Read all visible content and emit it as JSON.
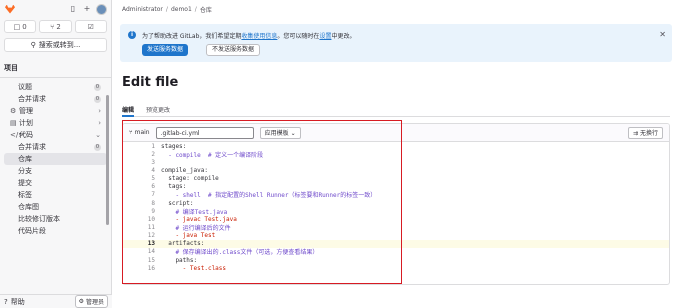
{
  "sidebar": {
    "counts": [
      {
        "icon": "□",
        "value": "0"
      },
      {
        "icon": "⑂",
        "value": "2"
      },
      {
        "icon": "☑",
        "value": ""
      }
    ],
    "search": "搜索或转到...",
    "project_label": "项目",
    "items": [
      {
        "label": "议题",
        "badge": "0",
        "sub": true
      },
      {
        "label": "合并请求",
        "badge": "0",
        "sub": true
      },
      {
        "label": "管理",
        "icon": "⚙",
        "chev": "›"
      },
      {
        "label": "计划",
        "icon": "▤",
        "chev": "›"
      },
      {
        "label": "代码",
        "icon": "</>",
        "chev": "⌄"
      },
      {
        "label": "合并请求",
        "badge": "0",
        "sub": true
      },
      {
        "label": "仓库",
        "sub": true,
        "active": true
      },
      {
        "label": "分支",
        "sub": true
      },
      {
        "label": "提交",
        "sub": true
      },
      {
        "label": "标签",
        "sub": true
      },
      {
        "label": "仓库图",
        "sub": true
      },
      {
        "label": "比较修订版本",
        "sub": true
      },
      {
        "label": "代码片段",
        "sub": true
      }
    ],
    "help": "帮助",
    "admin": "管理员"
  },
  "breadcrumb": [
    "Administrator",
    "demo1",
    "仓库"
  ],
  "alert": {
    "msg_pre": "为了帮助改进 GitLab，我们希望定期",
    "msg_link1": "收集使用信息",
    "msg_mid": "。您可以随时在",
    "msg_link2": "设置",
    "msg_post": "中更改。",
    "primary": "发送服务数据",
    "secondary": "不发送服务数据"
  },
  "page_title": "Edit file",
  "tabs": [
    "编辑",
    "预览更改"
  ],
  "editor": {
    "branch": "main",
    "filename": ".gitlab-ci.yml",
    "template_label": "应用模板",
    "wrap_label": "无换行",
    "lines": [
      {
        "n": "1",
        "t": "stages:"
      },
      {
        "n": "2",
        "t": "  - compile  # 定义一个编译阶段"
      },
      {
        "n": "3",
        "t": ""
      },
      {
        "n": "4",
        "t": "compile_java:"
      },
      {
        "n": "5",
        "t": "  stage: compile"
      },
      {
        "n": "6",
        "t": "  tags:"
      },
      {
        "n": "7",
        "t": "    - shell  # 指定配置的Shell Runner（标签要和Runner的标签一致）"
      },
      {
        "n": "8",
        "t": "  script:"
      },
      {
        "n": "9",
        "t": "    # 编译Test.java"
      },
      {
        "n": "10",
        "t": "    - javac Test.java"
      },
      {
        "n": "11",
        "t": "    # 运行编译后的文件"
      },
      {
        "n": "12",
        "t": "    - java Test"
      },
      {
        "n": "13",
        "t": "  artifacts:"
      },
      {
        "n": "14",
        "t": "    # 保存编译出的.class文件（可选，方便查看结果）"
      },
      {
        "n": "15",
        "t": "    paths:"
      },
      {
        "n": "16",
        "t": "      - Test.class"
      }
    ]
  },
  "colors": {
    "accent": "#1f75cb",
    "highlight": "#d71b23"
  }
}
